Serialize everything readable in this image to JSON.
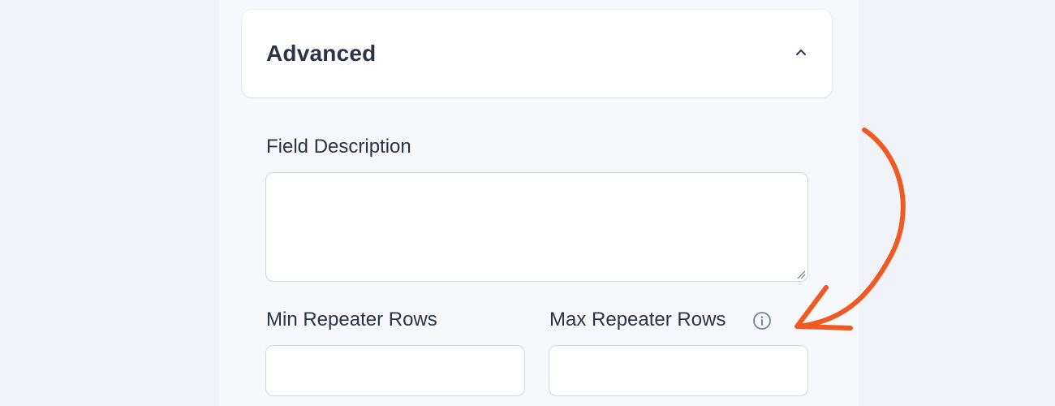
{
  "advanced": {
    "title": "Advanced",
    "expanded": true,
    "toggle_icon": "chevron-up-icon"
  },
  "field_description": {
    "label": "Field Description",
    "value": ""
  },
  "min_rows": {
    "label": "Min Repeater Rows",
    "value": ""
  },
  "max_rows": {
    "label": "Max Repeater Rows",
    "value": "",
    "help_icon": "info-icon"
  },
  "colors": {
    "annotation_arrow": "#f05a22",
    "text": "#2a3347",
    "border": "#d3d7e0"
  }
}
